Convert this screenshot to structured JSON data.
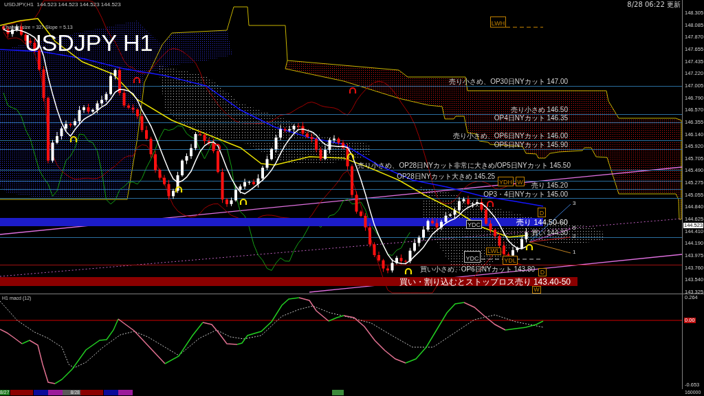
{
  "chart": {
    "symbol_info": "USDJPY,H1  144.523 144.523 144.523 144.523",
    "indicator_info": "Channel size = 327 Slope = 5.13",
    "title": "USDJPY H1",
    "updated": "8/28 06:22 更新",
    "levels": [
      {
        "label": "売り小さめ、OP30日NYカット 147.00",
        "kind": "line",
        "color": "#2a6e9e"
      },
      {
        "label": "売り小さめ 146.50",
        "kind": "line",
        "color": "#2a6e9e"
      },
      {
        "label": "OP4日NYカット 146.35",
        "kind": "line",
        "color": "#2a6e9e"
      },
      {
        "label": "売り小さめ、OP6日NYカット 146.00",
        "kind": "line",
        "color": "#2a6e9e"
      },
      {
        "label": "OP5日NYカット 145.90",
        "kind": "line",
        "color": "#2a6e9e"
      },
      {
        "label": "売り小さめ、OP28日NYカット非常に大きめ/OP5日NYカット 145.50",
        "kind": "line",
        "color": "#2a6e9e"
      },
      {
        "label": "OP28日NYカット大きめ 145.25",
        "kind": "line",
        "color": "#2a6e9e"
      },
      {
        "label": "売り 145.20",
        "kind": "line",
        "color": "#2a6e9e"
      },
      {
        "label": "OP3・4日NYカット 145.00",
        "kind": "line",
        "color": "#2a6e9e"
      },
      {
        "label": "売り 144.50-60",
        "kind": "band",
        "color": "#1c1cc8"
      },
      {
        "label": "買い 144.30",
        "kind": "line",
        "color": "#2a6e9e"
      },
      {
        "label": "買い小さめ、OP6日NYカット 143.80",
        "kind": "line",
        "color": "#a01010"
      },
      {
        "label": "買い・割り込むとストップロス売り 143.40-50",
        "kind": "band",
        "color": "#8b0000"
      }
    ],
    "markers": [
      {
        "label": "LWH",
        "color": "#c08000"
      },
      {
        "label": "YDH",
        "color": "#c08000"
      },
      {
        "label": "W",
        "color": "#c08000"
      },
      {
        "label": "D",
        "color": "#c08000"
      },
      {
        "label": "YDC",
        "color": "#c8c8c8"
      },
      {
        "label": "YDC",
        "color": "#c8c8c8"
      },
      {
        "label": "LWL",
        "color": "#c08000"
      },
      {
        "label": "YDL",
        "color": "#c08000"
      },
      {
        "label": "D",
        "color": "#c08000"
      },
      {
        "label": "W",
        "color": "#c08000"
      }
    ],
    "channel_labels": [
      "3",
      "5",
      "2",
      "1"
    ],
    "price_axis": [
      "148.305",
      "148.085",
      "147.870",
      "147.655",
      "147.435",
      "147.220",
      "147.005",
      "146.790",
      "146.570",
      "146.355",
      "146.140",
      "145.920",
      "145.705",
      "145.490",
      "145.275",
      "145.055",
      "144.840",
      "144.625",
      "144.410",
      "144.190",
      "143.975",
      "143.760",
      "143.540",
      "143.325"
    ],
    "current_price": "144.523"
  },
  "macd": {
    "title": "H1 macd (12)",
    "axis": [
      "0.264",
      "0.00",
      "-0.653"
    ]
  },
  "time_axis": {
    "labels": [
      {
        "text": "8/27",
        "color": "#1a7a1a"
      },
      {
        "text": "8/28",
        "color": "#5a5a5a"
      }
    ],
    "sessions": [
      {
        "color": "#8b0000"
      },
      {
        "color": "#0a0a9a"
      },
      {
        "color": "#9a1a9a"
      },
      {
        "color": "#8b0000"
      },
      {
        "color": "#0a0a9a"
      },
      {
        "color": "#9a1a9a"
      }
    ],
    "scale": "160000"
  }
}
